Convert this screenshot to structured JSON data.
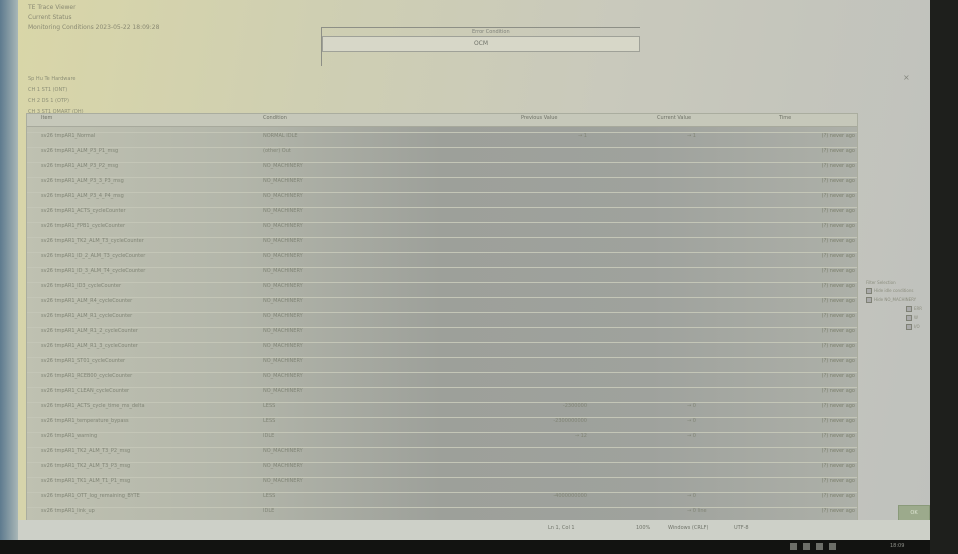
{
  "header": {
    "lines": [
      "TE Trace Viewer",
      "Current Status",
      "Monitoring Conditions 2023-05-22 18:09:28"
    ]
  },
  "message_box": {
    "caption": "Error Condition",
    "code": "OCM"
  },
  "close_icon": "×",
  "context_lines": [
    "Sp Hu Te Hardware",
    "CH 1 ST1 (ONT)",
    "CH 2 DS 1 (OTP)",
    "CH 3 ST1 OMART (DH)"
  ],
  "table": {
    "columns": [
      "Item",
      "Condition",
      "Previous Value",
      "Current Value",
      "Time"
    ],
    "rows": [
      {
        "name": "sv26 tmpAR1_Normal",
        "cond": "NORMAL IDLE",
        "prev": "→ 1",
        "cur": "→ 1",
        "time": "(?) never ago"
      },
      {
        "name": "sv26 tmpAR1_ALM_P3_P1_msg",
        "cond": "(other) Out",
        "prev": "",
        "cur": "",
        "time": "(?) never ago"
      },
      {
        "name": "sv26 tmpAR1_ALM_P3_P2_msg",
        "cond": "NO_MACHINERY",
        "prev": "",
        "cur": "",
        "time": "(?) never ago"
      },
      {
        "name": "sv26 tmpAR1_ALM_P3_3_P3_msg",
        "cond": "NO_MACHINERY",
        "prev": "",
        "cur": "",
        "time": "(?) never ago"
      },
      {
        "name": "sv26 tmpAR1_ALM_P3_4_P4_msg",
        "cond": "NO_MACHINERY",
        "prev": "",
        "cur": "",
        "time": "(?) never ago"
      },
      {
        "name": "sv26 tmpAR1_ACTS_cycleCounter",
        "cond": "NO_MACHINERY",
        "prev": "",
        "cur": "",
        "time": "(?) never ago"
      },
      {
        "name": "sv26 tmpAR1_FPB1_cycleCounter",
        "cond": "NO_MACHINERY",
        "prev": "",
        "cur": "",
        "time": "(?) never ago"
      },
      {
        "name": "sv26 tmpAR1_TK2_ALM_T3_cycleCounter",
        "cond": "NO_MACHINERY",
        "prev": "",
        "cur": "",
        "time": "(?) never ago"
      },
      {
        "name": "sv26 tmpAR1_ID_2_ALM_T3_cycleCounter",
        "cond": "NO_MACHINERY",
        "prev": "",
        "cur": "",
        "time": "(?) never ago"
      },
      {
        "name": "sv26 tmpAR1_ID_3_ALM_T4_cycleCounter",
        "cond": "NO_MACHINERY",
        "prev": "",
        "cur": "",
        "time": "(?) never ago"
      },
      {
        "name": "sv26 tmpAR1_ID3_cycleCounter",
        "cond": "NO_MACHINERY",
        "prev": "",
        "cur": "",
        "time": "(?) never ago"
      },
      {
        "name": "sv26 tmpAR1_ALM_R4_cycleCounter",
        "cond": "NO_MACHINERY",
        "prev": "",
        "cur": "",
        "time": "(?) never ago"
      },
      {
        "name": "sv26 tmpAR1_ALM_R1_cycleCounter",
        "cond": "NO_MACHINERY",
        "prev": "",
        "cur": "",
        "time": "(?) never ago"
      },
      {
        "name": "sv26 tmpAR1_ALM_R1_2_cycleCounter",
        "cond": "NO_MACHINERY",
        "prev": "",
        "cur": "",
        "time": "(?) never ago"
      },
      {
        "name": "sv26 tmpAR1_ALM_R1_3_cycleCounter",
        "cond": "NO_MACHINERY",
        "prev": "",
        "cur": "",
        "time": "(?) never ago"
      },
      {
        "name": "sv26 tmpAR1_ST01_cycleCounter",
        "cond": "NO_MACHINERY",
        "prev": "",
        "cur": "",
        "time": "(?) never ago"
      },
      {
        "name": "sv26 tmpAR1_RCEB00_cycleCounter",
        "cond": "NO_MACHINERY",
        "prev": "",
        "cur": "",
        "time": "(?) never ago"
      },
      {
        "name": "sv26 tmpAR1_CLEAN_cycleCounter",
        "cond": "NO_MACHINERY",
        "prev": "",
        "cur": "",
        "time": "(?) never ago"
      },
      {
        "name": "sv26 tmpAR1_ACTS_cycle_time_ms_delta",
        "cond": "LESS",
        "prev": "-2300000",
        "cur": "→ 0",
        "time": "(?) never ago"
      },
      {
        "name": "sv26 tmpAR1_temperature_bypass",
        "cond": "LESS",
        "prev": "-2300000000",
        "cur": "→ 0",
        "time": "(?) never ago"
      },
      {
        "name": "sv26 tmpAR1_warning",
        "cond": "IDLE",
        "prev": "→ 12",
        "cur": "→ 0",
        "time": "(?) never ago"
      },
      {
        "name": "sv26 tmpAR1_TK2_ALM_T3_P2_msg",
        "cond": "NO_MACHINERY",
        "prev": "",
        "cur": "",
        "time": "(?) never ago"
      },
      {
        "name": "sv26 tmpAR1_TK2_ALM_T3_P3_msg",
        "cond": "NO_MACHINERY",
        "prev": "",
        "cur": "",
        "time": "(?) never ago"
      },
      {
        "name": "sv26 tmpAR1_TK1_ALM_T1_P1_msg",
        "cond": "NO_MACHINERY",
        "prev": "",
        "cur": "",
        "time": "(?) never ago"
      },
      {
        "name": "sv26 tmpAR1_OTT_log_remaining_BYTE",
        "cond": "LESS",
        "prev": "-4000000000",
        "cur": "→ 0",
        "time": "(?) never ago"
      },
      {
        "name": "sv26 tmpAR1_link_up",
        "cond": "IDLE",
        "prev": "",
        "cur": "→ 0 line",
        "time": "(?) never ago"
      }
    ]
  },
  "filter_panel": {
    "title": "Filter Selection",
    "options": [
      "Hide idle conditions",
      "Hide NO_MACHINERY"
    ],
    "levels": [
      "ERR",
      "W",
      "I/O"
    ]
  },
  "status_bar": {
    "position": "Ln 1, Col 1",
    "zoom": "100%",
    "line_ending": "Windows (CRLF)",
    "encoding": "UTF-8"
  },
  "ok_button": "OK",
  "taskbar": {
    "time": "18:09"
  }
}
